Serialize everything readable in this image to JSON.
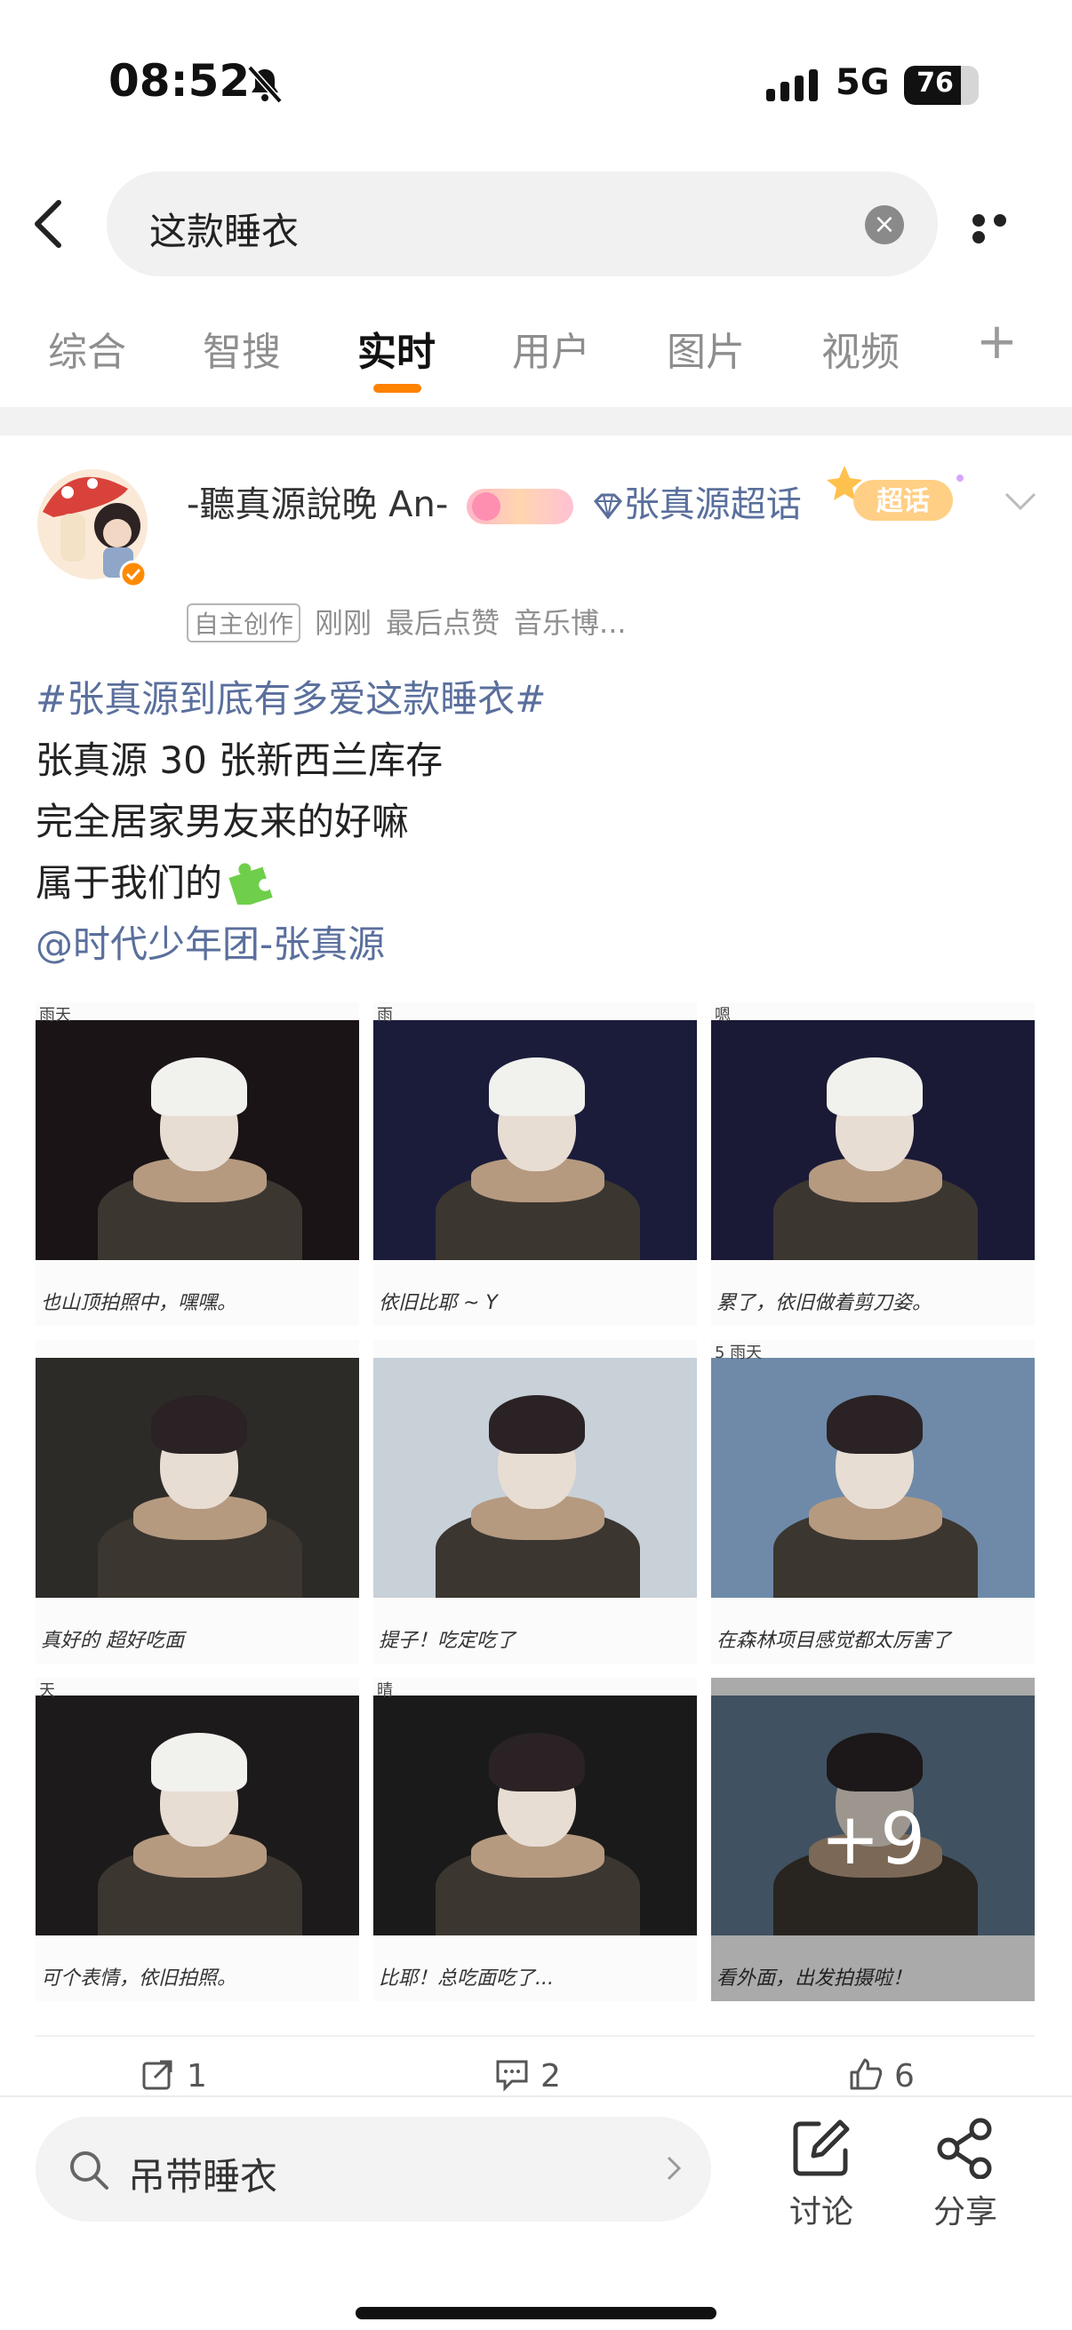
{
  "status": {
    "time": "08:52",
    "network": "5G",
    "battery": "76",
    "battery_level": 0.76
  },
  "search": {
    "query": "这款睡衣"
  },
  "tabs": [
    {
      "label": "综合"
    },
    {
      "label": "智搜"
    },
    {
      "label": "实时"
    },
    {
      "label": "用户"
    },
    {
      "label": "图片"
    },
    {
      "label": "视频"
    }
  ],
  "tab_more": "+",
  "post": {
    "author": "-聽真源說晚 An-",
    "supertopic_link": "张真源超话",
    "meta": {
      "tag": "自主创作",
      "time": "刚刚",
      "activity": "最后点赞",
      "source": "音乐博..."
    },
    "supertopic_badge": "超话",
    "body": {
      "topic": "#张真源到底有多爱这款睡衣#",
      "line1": "张真源 30 张新西兰库存",
      "line2": "完全居家男友来的好嘛",
      "line3": "属于我们的",
      "mention": "@时代少年团-张真源"
    },
    "photos": [
      {
        "caption": "也山顶拍照中，嘿嘿。",
        "mark": "雨天",
        "bg": "#1a1416"
      },
      {
        "caption": "依旧比耶 ~ Y",
        "mark": "雨",
        "bg": "#1a1c3a"
      },
      {
        "caption": "累了，依旧做着剪刀姿。",
        "mark": "嗯",
        "bg": "#1a1a36"
      },
      {
        "caption": "真好的 超好吃面",
        "mark": "",
        "bg": "#2d2b28"
      },
      {
        "caption": "提子！吃定吃了",
        "mark": "",
        "bg": "#c8d0d8"
      },
      {
        "caption": "在森林项目感觉都太厉害了",
        "mark": "5 雨天",
        "bg": "#6e8aa8"
      },
      {
        "caption": "可个表情，依旧拍照。",
        "mark": "天",
        "bg": "#1c1a1a"
      },
      {
        "caption": "比耶！总吃面吃了...",
        "mark": "晴",
        "bg": "#1a1a1a"
      },
      {
        "caption": "看外面，出发拍摄啦！",
        "mark": "",
        "bg": "#5f7890"
      }
    ],
    "more_count": "+9",
    "actions": {
      "reposts": "1",
      "comments": "2",
      "likes": "6"
    }
  },
  "bottom": {
    "hot_search": "吊带睡衣",
    "discuss_label": "讨论",
    "share_label": "分享"
  },
  "colors": {
    "accent": "#ff8200",
    "link": "#5a6f9c"
  }
}
